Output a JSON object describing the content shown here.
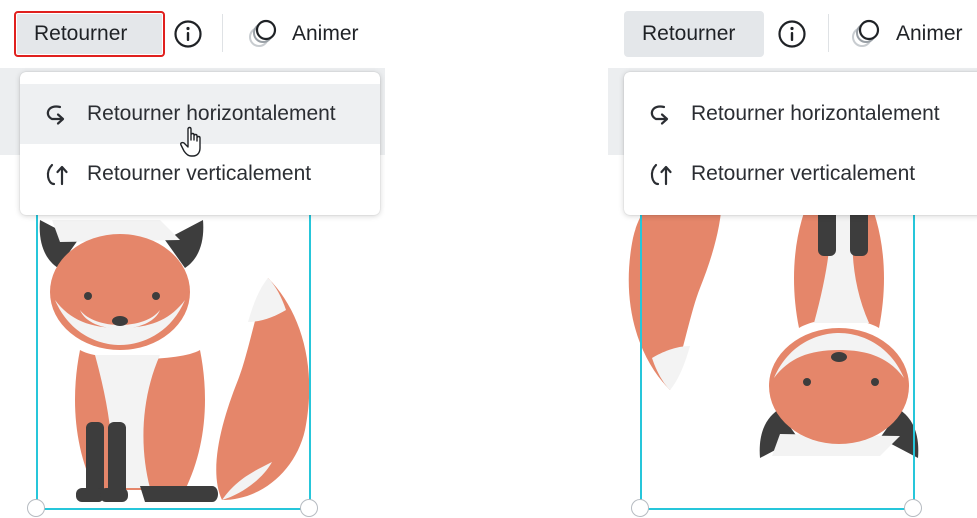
{
  "left_panel": {
    "flip_button_label": "Retourner",
    "animate_label": "Animer",
    "menu": {
      "items": [
        {
          "label": "Retourner horizontalement",
          "icon": "flip-horizontal-icon"
        },
        {
          "label": "Retourner verticalement",
          "icon": "flip-vertical-icon"
        }
      ]
    }
  },
  "right_panel": {
    "flip_button_label": "Retourner",
    "animate_label": "Animer",
    "menu": {
      "items": [
        {
          "label": "Retourner horizontalement",
          "icon": "flip-horizontal-icon"
        },
        {
          "label": "Retourner verticalement",
          "icon": "flip-vertical-icon"
        }
      ]
    }
  },
  "colors": {
    "highlight": "#e0201e",
    "selection": "#26c6da",
    "fox_orange": "#e5866a",
    "fox_dark": "#3d3d3d"
  }
}
